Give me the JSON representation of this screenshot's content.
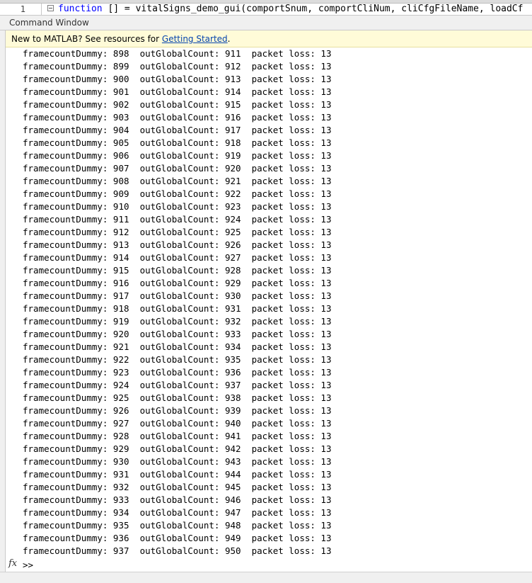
{
  "editor": {
    "line_number": "1",
    "code_keyword": "function",
    "code_rest": " [] = vitalSigns_demo_gui(comportSnum, comportCliNum, cliCfgFileName, loadCf"
  },
  "command_window": {
    "title": "Command Window",
    "banner_text": "New to MATLAB? See resources for ",
    "banner_link": "Getting Started",
    "banner_suffix": ".",
    "prompt": ">>",
    "fx_label": "fx",
    "lines": [
      "framecountDummy: 898  outGlobalCount: 911  packet loss: 13",
      "framecountDummy: 899  outGlobalCount: 912  packet loss: 13",
      "framecountDummy: 900  outGlobalCount: 913  packet loss: 13",
      "framecountDummy: 901  outGlobalCount: 914  packet loss: 13",
      "framecountDummy: 902  outGlobalCount: 915  packet loss: 13",
      "framecountDummy: 903  outGlobalCount: 916  packet loss: 13",
      "framecountDummy: 904  outGlobalCount: 917  packet loss: 13",
      "framecountDummy: 905  outGlobalCount: 918  packet loss: 13",
      "framecountDummy: 906  outGlobalCount: 919  packet loss: 13",
      "framecountDummy: 907  outGlobalCount: 920  packet loss: 13",
      "framecountDummy: 908  outGlobalCount: 921  packet loss: 13",
      "framecountDummy: 909  outGlobalCount: 922  packet loss: 13",
      "framecountDummy: 910  outGlobalCount: 923  packet loss: 13",
      "framecountDummy: 911  outGlobalCount: 924  packet loss: 13",
      "framecountDummy: 912  outGlobalCount: 925  packet loss: 13",
      "framecountDummy: 913  outGlobalCount: 926  packet loss: 13",
      "framecountDummy: 914  outGlobalCount: 927  packet loss: 13",
      "framecountDummy: 915  outGlobalCount: 928  packet loss: 13",
      "framecountDummy: 916  outGlobalCount: 929  packet loss: 13",
      "framecountDummy: 917  outGlobalCount: 930  packet loss: 13",
      "framecountDummy: 918  outGlobalCount: 931  packet loss: 13",
      "framecountDummy: 919  outGlobalCount: 932  packet loss: 13",
      "framecountDummy: 920  outGlobalCount: 933  packet loss: 13",
      "framecountDummy: 921  outGlobalCount: 934  packet loss: 13",
      "framecountDummy: 922  outGlobalCount: 935  packet loss: 13",
      "framecountDummy: 923  outGlobalCount: 936  packet loss: 13",
      "framecountDummy: 924  outGlobalCount: 937  packet loss: 13",
      "framecountDummy: 925  outGlobalCount: 938  packet loss: 13",
      "framecountDummy: 926  outGlobalCount: 939  packet loss: 13",
      "framecountDummy: 927  outGlobalCount: 940  packet loss: 13",
      "framecountDummy: 928  outGlobalCount: 941  packet loss: 13",
      "framecountDummy: 929  outGlobalCount: 942  packet loss: 13",
      "framecountDummy: 930  outGlobalCount: 943  packet loss: 13",
      "framecountDummy: 931  outGlobalCount: 944  packet loss: 13",
      "framecountDummy: 932  outGlobalCount: 945  packet loss: 13",
      "framecountDummy: 933  outGlobalCount: 946  packet loss: 13",
      "framecountDummy: 934  outGlobalCount: 947  packet loss: 13",
      "framecountDummy: 935  outGlobalCount: 948  packet loss: 13",
      "framecountDummy: 936  outGlobalCount: 949  packet loss: 13",
      "framecountDummy: 937  outGlobalCount: 950  packet loss: 13"
    ]
  },
  "colors": {
    "banner_bg": "#fffbd8",
    "link": "#0645ad",
    "keyword": "#0000ff"
  }
}
